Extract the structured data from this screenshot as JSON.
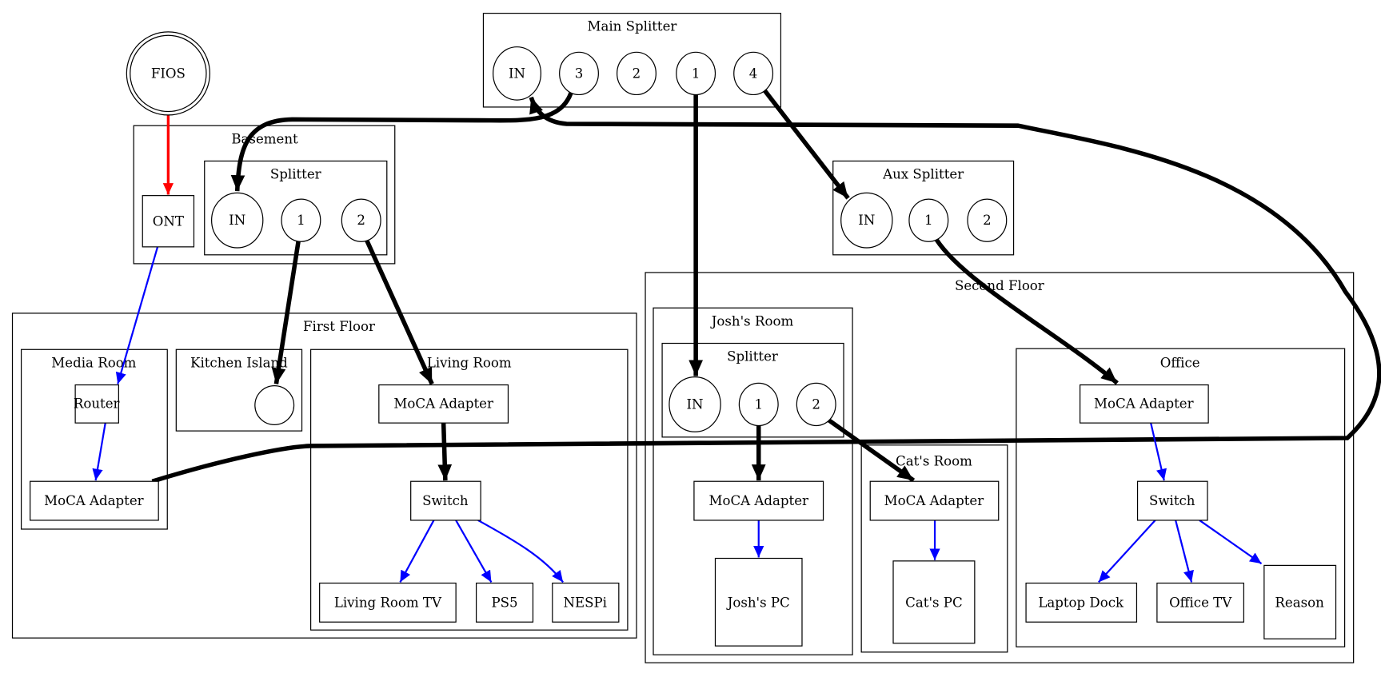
{
  "colors": {
    "fiber": "#ff0000",
    "ethernet": "#0000ff",
    "coax": "#000000"
  },
  "fios": "FIOS",
  "main_splitter": {
    "title": "Main Splitter",
    "ports": [
      "IN",
      "3",
      "2",
      "1",
      "4"
    ]
  },
  "basement": {
    "title": "Basement",
    "ont": "ONT",
    "splitter": {
      "title": "Splitter",
      "ports": [
        "IN",
        "1",
        "2"
      ]
    }
  },
  "aux_splitter": {
    "title": "Aux Splitter",
    "ports": [
      "IN",
      "1",
      "2"
    ]
  },
  "first_floor": {
    "title": "First Floor",
    "media_room": {
      "title": "Media Room",
      "router": "Router",
      "moca": "MoCA Adapter"
    },
    "kitchen_island": {
      "title": "Kitchen Island",
      "outlet": ""
    },
    "living_room": {
      "title": "Living Room",
      "moca": "MoCA Adapter",
      "switch": "Switch",
      "devices": [
        "Living Room TV",
        "PS5",
        "NESPi"
      ]
    }
  },
  "second_floor": {
    "title": "Second Floor",
    "joshs_room": {
      "title": "Josh's Room",
      "splitter": {
        "title": "Splitter",
        "ports": [
          "IN",
          "1",
          "2"
        ]
      },
      "moca": "MoCA Adapter",
      "pc": "Josh's PC"
    },
    "cats_room": {
      "title": "Cat's Room",
      "moca": "MoCA Adapter",
      "pc": "Cat's PC"
    },
    "office": {
      "title": "Office",
      "moca": "MoCA Adapter",
      "switch": "Switch",
      "devices": [
        "Laptop Dock",
        "Office TV",
        "Reason"
      ]
    }
  }
}
